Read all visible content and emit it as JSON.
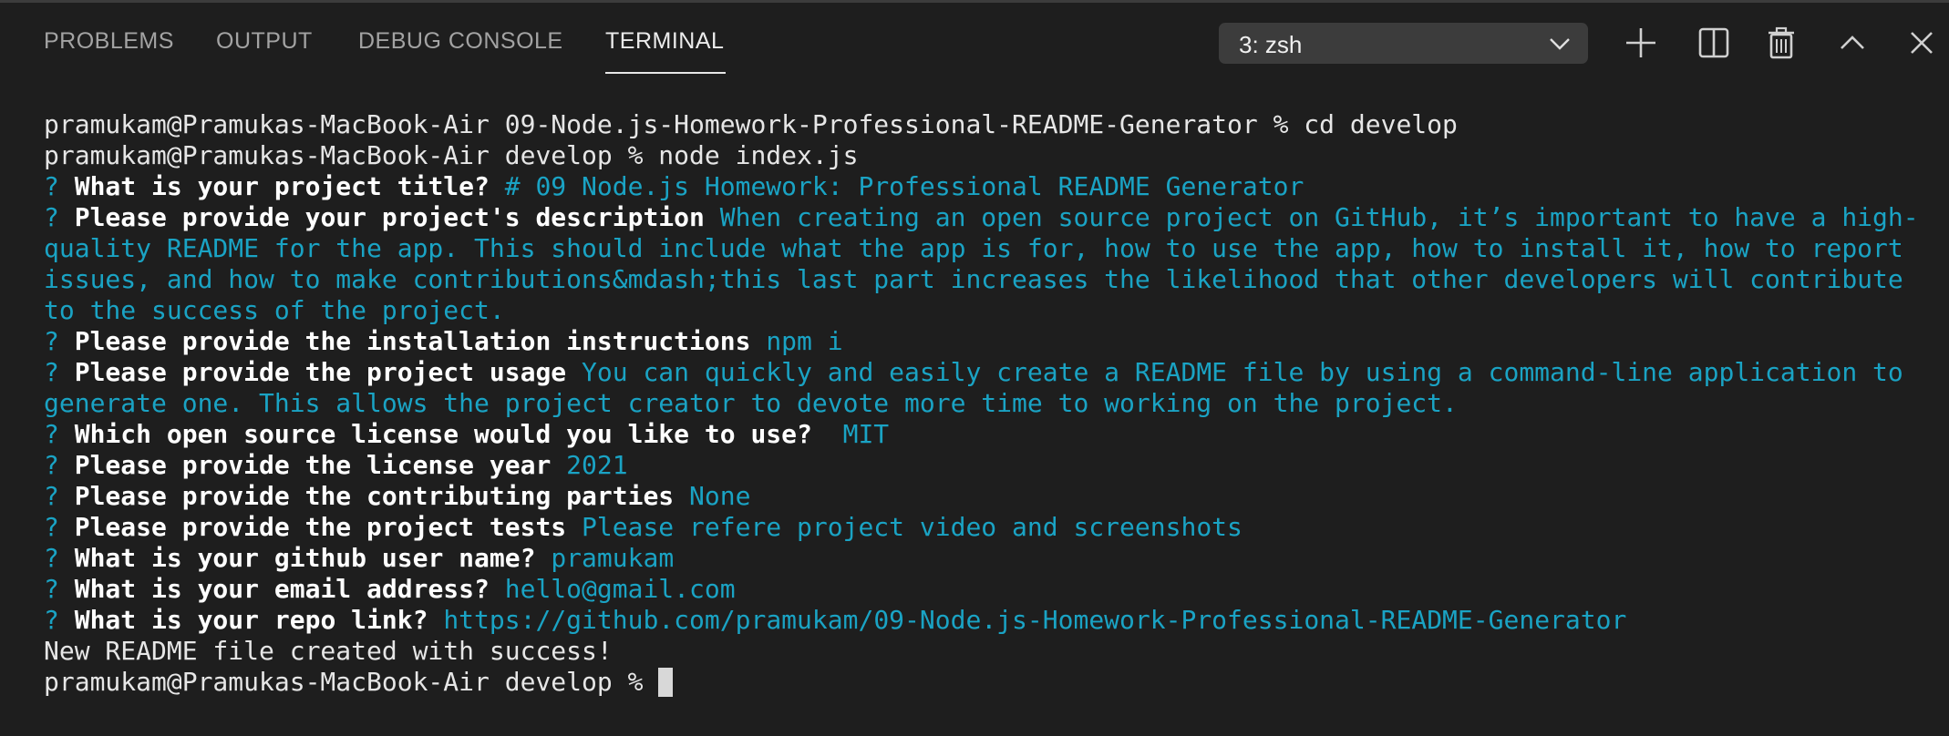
{
  "panel": {
    "tabs": [
      {
        "label": "PROBLEMS"
      },
      {
        "label": "OUTPUT"
      },
      {
        "label": "DEBUG CONSOLE"
      },
      {
        "label": "TERMINAL"
      }
    ],
    "active_tab": "TERMINAL",
    "terminal_select": {
      "value": "3: zsh"
    },
    "icons": [
      "plus-icon",
      "split-icon",
      "trash-icon",
      "chevron-up-icon",
      "close-icon"
    ]
  },
  "terminal": {
    "prompt1": "pramukam@Pramukas-MacBook-Air 09-Node.js-Homework-Professional-README-Generator % cd develop",
    "prompt2": "pramukam@Pramukas-MacBook-Air develop % node index.js",
    "qmark": "?",
    "q_title": "What is your project title?",
    "a_title": "# 09 Node.js Homework: Professional README Generator",
    "q_desc": "Please provide your project's description",
    "a_desc_1": "When creating an open source project on GitHub, it’s important to have a high-",
    "a_desc_2": "quality README for the app. This should include what the app is for, how to use the app, how to install it, how to report",
    "a_desc_3": "issues, and how to make contributions&mdash;this last part increases the likelihood that other developers will contribute",
    "a_desc_4": "to the success of the project.",
    "q_install": "Please provide the installation instructions",
    "a_install": "npm i",
    "q_usage": "Please provide the project usage",
    "a_usage_1": "You can quickly and easily create a README file by using a command-line application to",
    "a_usage_2": "generate one. This allows the project creator to devote more time to working on the project.",
    "q_license": "Which open source license would you like to use?",
    "a_license": " MIT",
    "q_year": "Please provide the license year",
    "a_year": "2021",
    "q_contrib": "Please provide the contributing parties",
    "a_contrib": "None",
    "q_tests": "Please provide the project tests",
    "a_tests": "Please refere project video and screenshots",
    "q_github": "What is your github user name?",
    "a_github": "pramukam",
    "q_email": "What is your email address?",
    "a_email": "hello@gmail.com",
    "q_repo": "What is your repo link?",
    "a_repo": "https://github.com/pramukam/09-Node.js-Homework-Professional-README-Generator",
    "success": "New README file created with success!",
    "prompt3": "pramukam@Pramukas-MacBook-Air develop % "
  },
  "colors": {
    "background": "#1e1e1e",
    "answer": "#1aa3c4",
    "text": "#e6e6e6",
    "tab_inactive": "#a3a3a3",
    "dropdown_bg": "#3c3c3c"
  }
}
